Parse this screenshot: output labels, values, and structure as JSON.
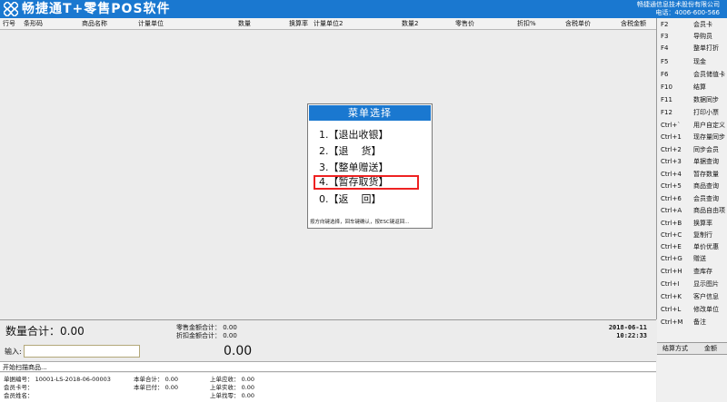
{
  "header": {
    "title": "畅捷通T+零售POS软件",
    "company": "畅捷通信息技术股份有限公司",
    "phone": "电话：4006-600-566"
  },
  "grid": {
    "columns": [
      "行号",
      "条形码",
      "商品名称",
      "计量单位",
      "数量",
      "换算率",
      "计量单位2",
      "数量2",
      "零售价",
      "折扣%",
      "含税单价",
      "含税金额"
    ]
  },
  "function_keys": [
    {
      "key": "F2",
      "label": "会员卡"
    },
    {
      "key": "F3",
      "label": "导购员"
    },
    {
      "key": "F4",
      "label": "整单打折"
    },
    {
      "key": "F5",
      "label": "现金"
    },
    {
      "key": "F6",
      "label": "会员储值卡"
    },
    {
      "key": "F10",
      "label": "结算"
    },
    {
      "key": "F11",
      "label": "数据同步"
    },
    {
      "key": "F12",
      "label": "打印小票"
    },
    {
      "key": "Ctrl+`",
      "label": "用户自定义"
    },
    {
      "key": "Ctrl+1",
      "label": "现存量同步"
    },
    {
      "key": "Ctrl+2",
      "label": "同步会员"
    },
    {
      "key": "Ctrl+3",
      "label": "单据查询"
    },
    {
      "key": "Ctrl+4",
      "label": "暂存数量"
    },
    {
      "key": "Ctrl+5",
      "label": "商品查询"
    },
    {
      "key": "Ctrl+6",
      "label": "会员查询"
    },
    {
      "key": "Ctrl+A",
      "label": "商品自由项"
    },
    {
      "key": "Ctrl+B",
      "label": "换算率"
    },
    {
      "key": "Ctrl+C",
      "label": "复制行"
    },
    {
      "key": "Ctrl+E",
      "label": "单价优惠"
    },
    {
      "key": "Ctrl+G",
      "label": "赠送"
    },
    {
      "key": "Ctrl+H",
      "label": "查库存"
    },
    {
      "key": "Ctrl+I",
      "label": "显示图片"
    },
    {
      "key": "Ctrl+K",
      "label": "客户信息"
    },
    {
      "key": "Ctrl+L",
      "label": "修改单位"
    },
    {
      "key": "Ctrl+M",
      "label": "备注"
    }
  ],
  "settlement": {
    "col1": "结算方式",
    "col2": "金额"
  },
  "summary": {
    "qty_label": "数量合计：",
    "qty_value": "0.00",
    "retail_total": "零售金额合计：  0.00",
    "discount_total": "折扣金额合计：  0.00",
    "date": "2018-06-11",
    "time": "10:22:33"
  },
  "input": {
    "label": "输入:",
    "value": "",
    "amount": "0.00"
  },
  "status": "开始扫描商品...",
  "info": {
    "doc_no": "单据编号：  10001-LS-2018-06-00003",
    "member_card": "会员卡号：",
    "member_name": "会员姓名：",
    "total": "本单合计：  0.00",
    "paid": "本单已付：  0.00",
    "last_receivable": "上单应收：  0.00",
    "last_received": "上单实收：  0.00",
    "last_change": "上单找零：  0.00"
  },
  "modal": {
    "title": "菜单选择",
    "items": [
      "1.【退出收银】",
      "2.【退    货】",
      "3.【整单赠送】",
      "4.【暂存取货】",
      "0.【返    回】"
    ],
    "selected_index": 3,
    "hint": "按方向键选择，回车键确认，按ESC键返回..."
  }
}
